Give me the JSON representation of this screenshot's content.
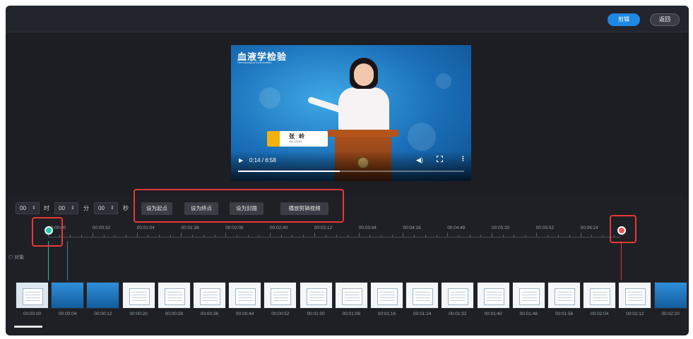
{
  "header": {
    "clip_label": "剪辑",
    "back_label": "返回"
  },
  "video": {
    "title": "血液学检验",
    "subtitle": "Hematological Examination",
    "presenter_name": "张 岭",
    "presenter_caption": "教授 主讲老师",
    "time": "0:14 / 6:58",
    "progress": 0.45
  },
  "time_input": {
    "hours": "00",
    "hours_unit": "时",
    "minutes": "00",
    "minutes_unit": "分",
    "seconds": "00",
    "seconds_unit": "秒"
  },
  "actions": {
    "set_start": "设为起点",
    "set_end": "设为终点",
    "set_cover": "设为封面",
    "play_clip": "播放剪辑视频"
  },
  "timeline": {
    "track_label": "对象",
    "ruler_ticks": [
      "00:00:00",
      "00:00:32",
      "00:01:04",
      "00:01:36",
      "00:02:08",
      "00:02:40",
      "00:03:12",
      "00:03:44",
      "00:04:16",
      "00:04:48",
      "00:05:20",
      "00:05:52",
      "00:06:24"
    ],
    "thumbnails": [
      {
        "time": "00:00:00",
        "kind": "light"
      },
      {
        "time": "00:00:04",
        "kind": "blue"
      },
      {
        "time": "00:00:12",
        "kind": "blue"
      },
      {
        "time": "00:00:20",
        "kind": "doc"
      },
      {
        "time": "00:00:28",
        "kind": "doc"
      },
      {
        "time": "00:00:36",
        "kind": "doc"
      },
      {
        "time": "00:00:44",
        "kind": "doc"
      },
      {
        "time": "00:00:52",
        "kind": "doc"
      },
      {
        "time": "00:01:00",
        "kind": "doc"
      },
      {
        "time": "00:01:08",
        "kind": "doc"
      },
      {
        "time": "00:01:16",
        "kind": "doc"
      },
      {
        "time": "00:01:24",
        "kind": "doc"
      },
      {
        "time": "00:01:32",
        "kind": "doc"
      },
      {
        "time": "00:01:40",
        "kind": "doc"
      },
      {
        "time": "00:01:48",
        "kind": "doc"
      },
      {
        "time": "00:01:56",
        "kind": "doc"
      },
      {
        "time": "00:02:04",
        "kind": "doc"
      },
      {
        "time": "00:02:12",
        "kind": "doc"
      },
      {
        "time": "00:02:20",
        "kind": "blue"
      }
    ]
  },
  "colors": {
    "accent": "#1e88e5",
    "start_marker": "#2bc4a8",
    "end_marker": "#ef5350",
    "highlight_box": "#e53935"
  }
}
